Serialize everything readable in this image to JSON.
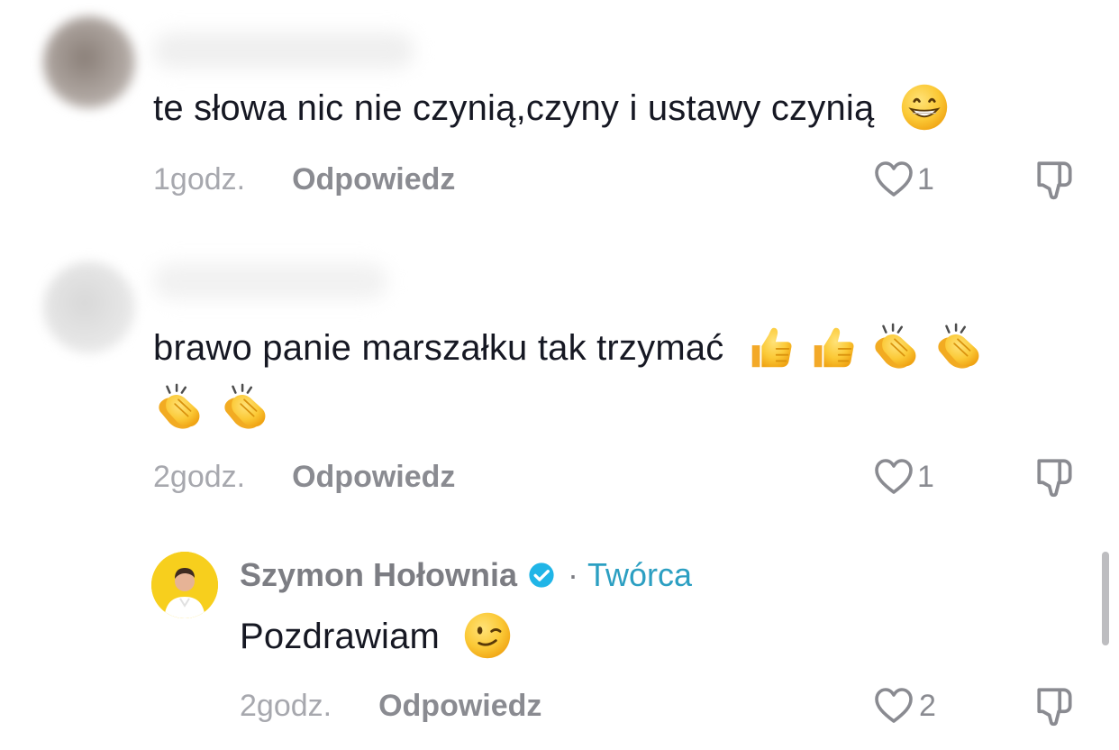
{
  "comments": [
    {
      "text": "te słowa nic nie czynią,czyny i ustawy czynią",
      "emoji": [
        "grinning-face"
      ],
      "time": "1godz.",
      "reply_label": "Odpowiedz",
      "likes": "1"
    },
    {
      "text": "brawo panie marszałku tak trzymać",
      "emoji": [
        "thumbs-up",
        "thumbs-up",
        "clapping-hands",
        "clapping-hands",
        "clapping-hands",
        "clapping-hands"
      ],
      "time": "2godz.",
      "reply_label": "Odpowiedz",
      "likes": "1"
    }
  ],
  "reply": {
    "author": "Szymon Hołownia",
    "verified": true,
    "separator": "·",
    "badge": "Twórca",
    "text": "Pozdrawiam",
    "emoji": [
      "winking-face"
    ],
    "time": "2godz.",
    "reply_label": "Odpowiedz",
    "likes": "2"
  },
  "colors": {
    "text": "#161823",
    "meta_gray": "#a7a8ae",
    "reply_gray": "#8a8b91",
    "verified_blue": "#20b5e7",
    "creator_label": "#2c9fc2",
    "avatar_yellow": "#f7cf1d",
    "emoji_yellow": "#fbc02d"
  }
}
